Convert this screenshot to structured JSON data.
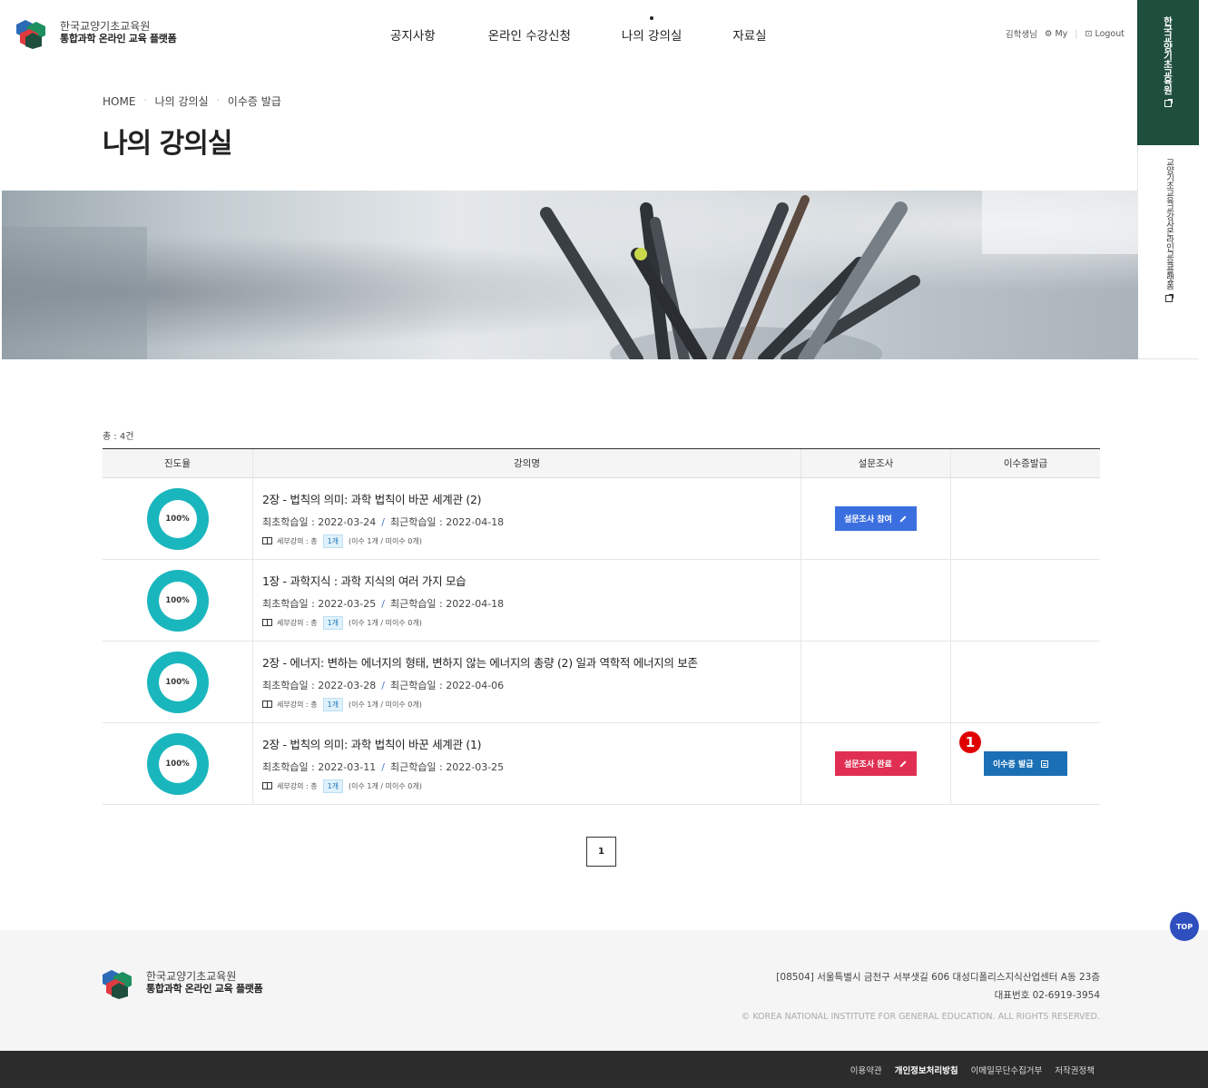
{
  "header": {
    "logo_line1": "한국교양기초교육원",
    "logo_line2": "통합과학 온라인 교육 플랫폼",
    "nav": [
      "공지사항",
      "온라인 수강신청",
      "나의 강의실",
      "자료실"
    ],
    "active_nav": "나의 강의실",
    "user": "김학생님",
    "my_label": "My",
    "logout_label": "Logout"
  },
  "side": {
    "green_label": "한국교양기초교육원",
    "white_label": "교양기초교육교강사온라인교육플랫폼"
  },
  "breadcrumb": [
    "HOME",
    "나의 강의실",
    "이수증 발급"
  ],
  "page_title": "나의 강의실",
  "total": "총 : 4건",
  "table": {
    "headers": [
      "진도율",
      "강의명",
      "설문조사",
      "이수증발급"
    ],
    "rows": [
      {
        "progress": "100%",
        "title": "2장 - 법칙의 의미: 과학 법칙이 바꾼 세계관 (2)",
        "first_date": "최초학습일 : 2022-03-24",
        "last_date": "최근학습일 : 2022-04-18",
        "meta_prefix": "세부강의 : 총",
        "meta_count": "1개",
        "meta_done": "(이수 1개 / 미이수 0개)",
        "survey": "설문조사 참여",
        "cert": ""
      },
      {
        "progress": "100%",
        "title": "1장 - 과학지식 : 과학 지식의 여러 가지 모습",
        "first_date": "최초학습일 : 2022-03-25",
        "last_date": "최근학습일 : 2022-04-18",
        "meta_prefix": "세부강의 : 총",
        "meta_count": "1개",
        "meta_done": "(이수 1개 / 미이수 0개)",
        "survey": "",
        "cert": ""
      },
      {
        "progress": "100%",
        "title": "2장 - 에너지: 변하는 에너지의 형태, 변하지 않는 에너지의 총량 (2) 일과 역학적 에너지의 보존",
        "first_date": "최초학습일 : 2022-03-28",
        "last_date": "최근학습일 : 2022-04-06",
        "meta_prefix": "세부강의 : 총",
        "meta_count": "1개",
        "meta_done": "(이수 1개 / 미이수 0개)",
        "survey": "",
        "cert": ""
      },
      {
        "progress": "100%",
        "title": "2장 - 법칙의 의미: 과학 법칙이 바꾼 세계관 (1)",
        "first_date": "최초학습일 : 2022-03-11",
        "last_date": "최근학습일 : 2022-03-25",
        "meta_prefix": "세부강의 : 총",
        "meta_count": "1개",
        "meta_done": "(이수 1개 / 미이수 0개)",
        "survey": "설문조사 완료",
        "cert": "이수증 발급"
      }
    ]
  },
  "annotation_number": "1",
  "pager": {
    "current": "1"
  },
  "top_label": "TOP",
  "footer": {
    "logo_line1": "한국교양기초교육원",
    "logo_line2": "통합과학 온라인 교육 플랫폼",
    "address": "[08504] 서울특별시 금천구 서부샛길 606 대성디폴리스지식산업센터 A동 23층",
    "phone": "대표번호 02-6919-3954",
    "copyright": "© KOREA NATIONAL INSTITUTE FOR GENERAL EDUCATION. ALL RIGHTS RESERVED.",
    "links": [
      "이용약관",
      "개인정보처리방침",
      "이메일무단수집거부",
      "저작권정책"
    ]
  },
  "colors": {
    "donut": "#1ab6bd",
    "survey_join": "#3b6fe0",
    "survey_done": "#e02f52",
    "cert": "#1b6fb5",
    "side_green": "#1f4e3d"
  }
}
